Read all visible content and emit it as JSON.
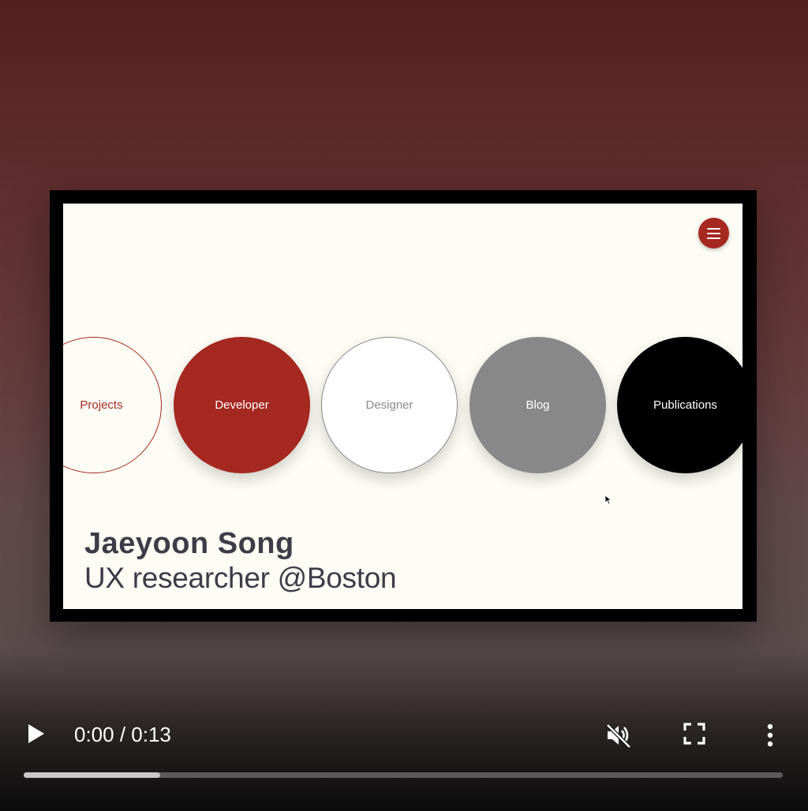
{
  "site": {
    "menu_icon": "hamburger-menu-icon",
    "circles": [
      {
        "label": "Projects"
      },
      {
        "label": "Developer"
      },
      {
        "label": "Designer"
      },
      {
        "label": "Blog"
      },
      {
        "label": "Publications"
      }
    ],
    "name": "Jaeyoon Song",
    "tagline": "UX researcher @Boston",
    "accent_color": "#a52821"
  },
  "player": {
    "play_icon": "play-icon",
    "time": "0:00 / 0:13",
    "mute_icon": "muted-speaker-icon",
    "fullscreen_icon": "fullscreen-icon",
    "more_icon": "more-vertical-icon",
    "buffered_fraction": 0.18
  }
}
